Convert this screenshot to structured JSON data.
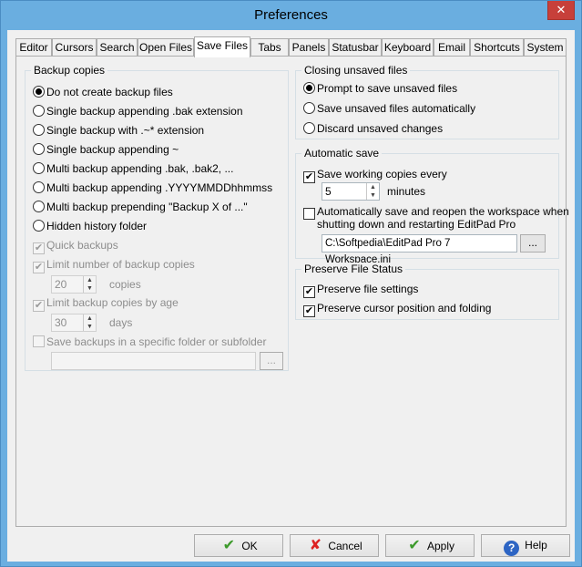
{
  "window": {
    "title": "Preferences",
    "close_glyph": "✕"
  },
  "tabs": [
    "Editor",
    "Cursors",
    "Search",
    "Open Files",
    "Save Files",
    "Tabs",
    "Panels",
    "Statusbar",
    "Keyboard",
    "Email",
    "Shortcuts",
    "System"
  ],
  "active_tab": "Save Files",
  "backup": {
    "title": "Backup copies",
    "options": [
      "Do not create backup files",
      "Single backup appending .bak extension",
      "Single backup with .~* extension",
      "Single backup appending ~",
      "Multi backup appending .bak, .bak2, ...",
      "Multi backup appending .YYYYMMDDhhmmss",
      "Multi backup prepending \"Backup X of ...\"",
      "Hidden history folder"
    ],
    "selected_index": 0,
    "quick_backups": "Quick backups",
    "limit_number": "Limit number of backup copies",
    "limit_number_value": "20",
    "limit_number_unit": "copies",
    "limit_age": "Limit backup copies by age",
    "limit_age_value": "30",
    "limit_age_unit": "days",
    "specific_folder": "Save backups in a specific folder or subfolder",
    "folder_value": "",
    "browse_label": "..."
  },
  "closing": {
    "title": "Closing unsaved files",
    "options": [
      "Prompt to save unsaved files",
      "Save unsaved files automatically",
      "Discard unsaved changes"
    ],
    "selected_index": 0
  },
  "autosave": {
    "title": "Automatic save",
    "save_working": "Save working copies every",
    "interval_value": "5",
    "interval_unit": "minutes",
    "auto_reopen_line1": "Automatically save and reopen the workspace when",
    "auto_reopen_line2": "shutting down and restarting EditPad Pro",
    "workspace_path": "C:\\Softpedia\\EditPad Pro 7 Workspace.ini",
    "browse_label": "..."
  },
  "preserve": {
    "title": "Preserve File Status",
    "file_settings": "Preserve file settings",
    "cursor_position": "Preserve cursor position and folding"
  },
  "buttons": {
    "ok": "OK",
    "cancel": "Cancel",
    "apply": "Apply",
    "help": "Help"
  },
  "icons": {
    "ok": "✔",
    "cancel": "✘",
    "apply": "✔",
    "help": "?"
  }
}
